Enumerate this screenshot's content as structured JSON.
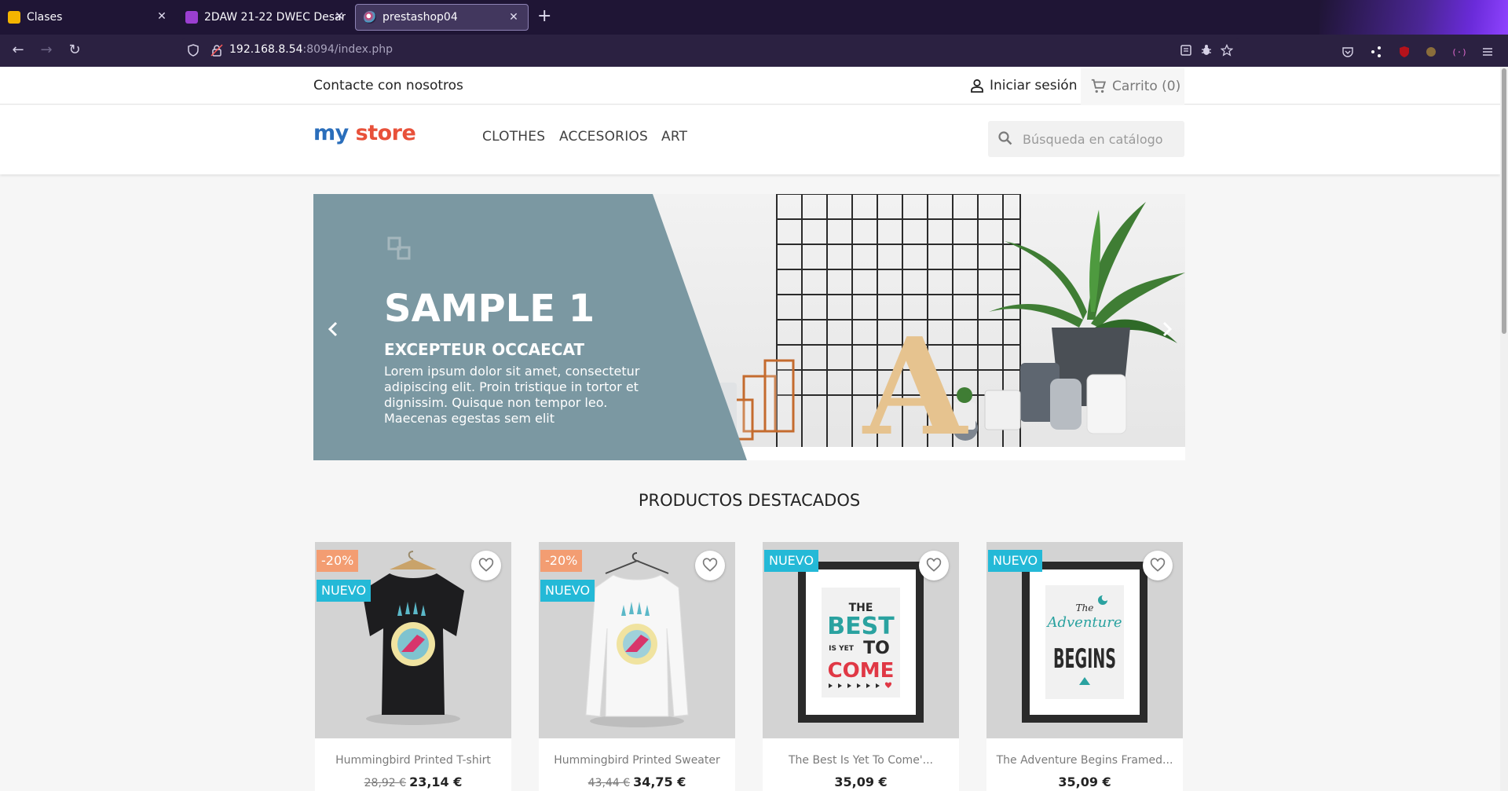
{
  "browser": {
    "tabs": [
      {
        "title": "Clases",
        "icon": "classroom-icon"
      },
      {
        "title": "2DAW 21-22 DWEC Desarrollo",
        "icon": "moodle-icon"
      },
      {
        "title": "prestashop04",
        "icon": "prestashop-icon"
      }
    ],
    "url_host": "192.168.8.54",
    "url_path": ":8094/index.php"
  },
  "header": {
    "contact": "Contacte con nosotros",
    "signin": "Iniciar sesión",
    "cart": "Carrito",
    "cart_count": "(0)"
  },
  "logo": {
    "part1": "my",
    "part2": "store"
  },
  "menu": [
    "CLOTHES",
    "ACCESORIOS",
    "ART"
  ],
  "search": {
    "placeholder": "Búsqueda en catálogo"
  },
  "slider": {
    "title": "SAMPLE 1",
    "subtitle": "EXCEPTEUR OCCAECAT",
    "text": "Lorem ipsum dolor sit amet, consectetur adipiscing elit. Proin tristique in tortor et dignissim. Quisque non tempor leo. Maecenas egestas sem elit",
    "letter": "A",
    "panel_color": "#7b98a2"
  },
  "featured": {
    "title": "PRODUCTOS DESTACADOS",
    "products": [
      {
        "name": "Hummingbird Printed T-shirt",
        "regular": "28,92 €",
        "price": "23,14 €",
        "discount": "-20%",
        "new": "NUEVO"
      },
      {
        "name": "Hummingbird Printed Sweater",
        "regular": "43,44 €",
        "price": "34,75 €",
        "discount": "-20%",
        "new": "NUEVO"
      },
      {
        "name": "The Best Is Yet To Come'...",
        "regular": "",
        "price": "35,09 €",
        "discount": "",
        "new": "NUEVO"
      },
      {
        "name": "The Adventure Begins Framed...",
        "regular": "",
        "price": "35,09 €",
        "discount": "",
        "new": "NUEVO"
      }
    ],
    "poster1_lines": [
      "THE",
      "BEST",
      "IS YET",
      "TO",
      "COME"
    ],
    "poster2_lines": [
      "The",
      "Adventure",
      "BEGINS"
    ]
  },
  "colors": {
    "accent": "#24b9d7",
    "discount": "#f39d72",
    "browser_bg": "#1f1535"
  }
}
